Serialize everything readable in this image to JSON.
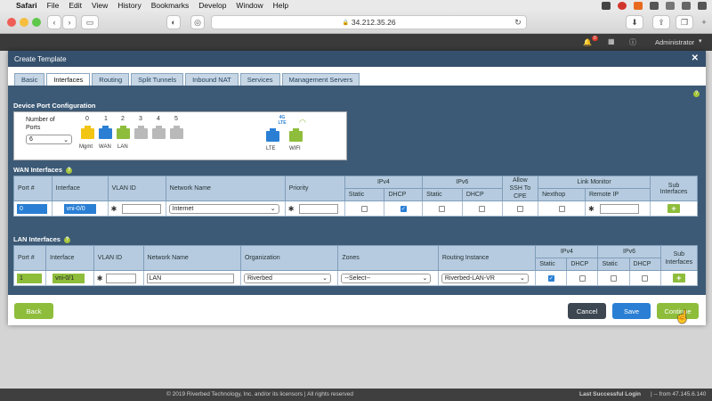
{
  "menubar": {
    "apple": "",
    "app": "Safari",
    "items": [
      "File",
      "Edit",
      "View",
      "History",
      "Bookmarks",
      "Develop",
      "Window",
      "Help"
    ]
  },
  "browser": {
    "url": "34.212.35.26",
    "lock": "🔒"
  },
  "app_header": {
    "user": "Administrator",
    "badge": "0"
  },
  "footer": {
    "copyright": "© 2019 Riverbed Technology, Inc. and/or its licensors | All rights reserved",
    "last_login_label": "Last Successful Login",
    "last_login_value": "| -- from 47.145.6.140"
  },
  "modal": {
    "title": "Create Template",
    "close": "✕",
    "tabs": [
      "Basic",
      "Interfaces",
      "Routing",
      "Split Tunnels",
      "Inbound NAT",
      "Services",
      "Management Servers"
    ],
    "active_tab": "Interfaces",
    "dpc": {
      "title": "Device Port Configuration",
      "num_ports_label": "Number of Ports",
      "num_ports_value": "6",
      "ports": [
        "0",
        "1",
        "2",
        "3",
        "4",
        "5"
      ],
      "port_colors": [
        "#f2c413",
        "#2a7fd4",
        "#8ebd3c",
        "#b9b9b9",
        "#b9b9b9",
        "#b9b9b9"
      ],
      "port_labels": [
        "Mgmt",
        "WAN",
        "LAN"
      ],
      "lte_label": "LTE",
      "wifi_label": "WIFI",
      "lte_tag": "4G LTE"
    },
    "wan": {
      "title": "WAN Interfaces",
      "headers": {
        "port": "Port #",
        "interface": "Interface",
        "vlan": "VLAN ID",
        "network": "Network Name",
        "priority": "Priority",
        "ipv4": "IPv4",
        "ipv6": "IPv6",
        "ssh": "Allow SSH To CPE",
        "link": "Link Monitor",
        "sub": "Sub Interfaces",
        "static": "Static",
        "dhcp": "DHCP",
        "nexthop": "Nexthop",
        "remoteip": "Remote IP"
      },
      "row": {
        "port": "0",
        "interface": "vni-0/0",
        "network": "Internet",
        "vlan": "",
        "priority": "",
        "remote_ip": ""
      }
    },
    "lan": {
      "title": "LAN Interfaces",
      "headers": {
        "port": "Port #",
        "interface": "Interface",
        "vlan": "VLAN ID",
        "network": "Network Name",
        "org": "Organization",
        "zones": "Zones",
        "ri": "Routing Instance",
        "ipv4": "IPv4",
        "ipv6": "IPv6",
        "sub": "Sub Interfaces",
        "static": "Static",
        "dhcp": "DHCP"
      },
      "row": {
        "port": "1",
        "interface": "vni-0/1",
        "network": "LAN",
        "org": "Riverbed",
        "zones": "--Select--",
        "ri": "Riverbed-LAN-VR",
        "vlan": ""
      }
    },
    "buttons": {
      "back": "Back",
      "cancel": "Cancel",
      "save": "Save",
      "continue": "Continue"
    },
    "colors": {
      "header": "#34506c",
      "body": "#3c5a76",
      "green": "#8ebd3c",
      "blue": "#2a7fd4",
      "dark": "#3d4752"
    }
  }
}
